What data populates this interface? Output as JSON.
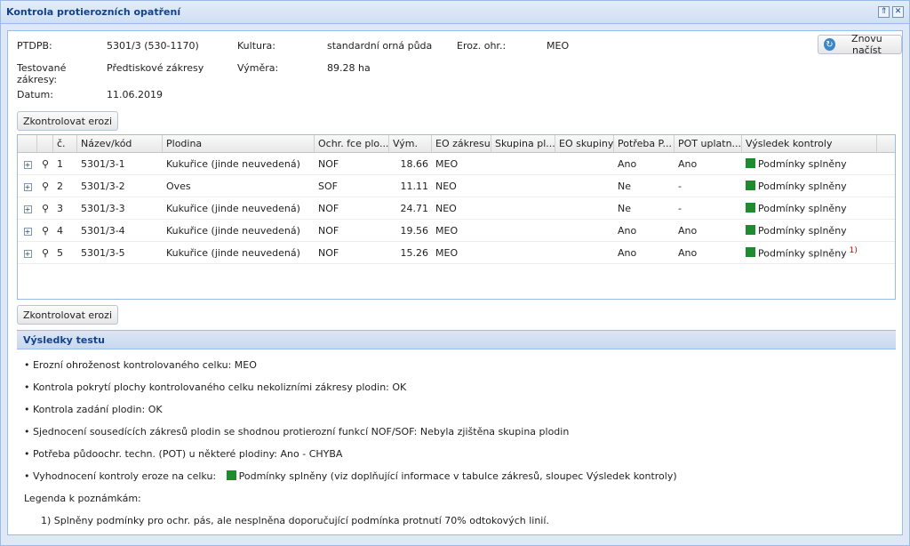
{
  "window": {
    "title": "Kontrola protierozních opatření",
    "tool_collapse": "⇑",
    "tool_close": "✕"
  },
  "info": {
    "ptdpb_label": "PTDPB:",
    "ptdpb_value": "5301/3 (530-1170)",
    "kultura_label": "Kultura:",
    "kultura_value": "standardní orná půda",
    "eroz_label": "Eroz. ohr.:",
    "eroz_value": "MEO",
    "testovane_label": "Testované zákresy:",
    "testovane_value": "Předtiskové zákresy",
    "vymera_label": "Výměra:",
    "vymera_value": "89.28 ha",
    "datum_label": "Datum:",
    "datum_value": "11.06.2019"
  },
  "buttons": {
    "reload": "Znovu načíst",
    "check_top": "Zkontrolovat erozi",
    "check_bottom": "Zkontrolovat erozi"
  },
  "grid": {
    "headers": [
      "",
      "",
      "č.",
      "Název/kód",
      "Plodina",
      "Ochr. fce plo...",
      "Vým.",
      "EO zákresu",
      "Skupina pl...",
      "EO skupiny",
      "Potřeba P...",
      "POT uplatn...",
      "Výsledek kontroly"
    ],
    "rows": [
      {
        "n": "1",
        "kod": "5301/3-1",
        "plodina": "Kukuřice (jinde neuvedená)",
        "fce": "NOF",
        "vym": "18.66",
        "eo": "MEO",
        "skup": "",
        "eos": "",
        "potreba": "Ano",
        "pot": "Ano",
        "vysledek": "Podmínky splněny",
        "note": ""
      },
      {
        "n": "2",
        "kod": "5301/3-2",
        "plodina": "Oves",
        "fce": "SOF",
        "vym": "11.11",
        "eo": "NEO",
        "skup": "",
        "eos": "",
        "potreba": "Ne",
        "pot": "-",
        "vysledek": "Podmínky splněny",
        "note": ""
      },
      {
        "n": "3",
        "kod": "5301/3-3",
        "plodina": "Kukuřice (jinde neuvedená)",
        "fce": "NOF",
        "vym": "24.71",
        "eo": "NEO",
        "skup": "",
        "eos": "",
        "potreba": "Ne",
        "pot": "-",
        "vysledek": "Podmínky splněny",
        "note": ""
      },
      {
        "n": "4",
        "kod": "5301/3-4",
        "plodina": "Kukuřice (jinde neuvedená)",
        "fce": "NOF",
        "vym": "19.56",
        "eo": "MEO",
        "skup": "",
        "eos": "",
        "potreba": "Ano",
        "pot": "Ano",
        "vysledek": "Podmínky splněny",
        "note": ""
      },
      {
        "n": "5",
        "kod": "5301/3-5",
        "plodina": "Kukuřice (jinde neuvedená)",
        "fce": "NOF",
        "vym": "15.26",
        "eo": "MEO",
        "skup": "",
        "eos": "",
        "potreba": "Ano",
        "pot": "Ano",
        "vysledek": "Podmínky splněny",
        "note": "1)"
      }
    ],
    "status_color": "#1e8c2e"
  },
  "results": {
    "title": "Výsledky testu",
    "l1": "• Erozní ohroženost kontrolovaného celku:   MEO",
    "l2": "• Kontrola pokrytí plochy kontrolovaného celku nekolizními zákresy plodin:  OK",
    "l3": "• Kontrola zadání plodin:      OK",
    "l4": "• Sjednocení sousedících zákresů plodin se shodnou protierozní funkcí NOF/SOF:    Nebyla zjištěna skupina plodin",
    "l5": "• Potřeba půdoochr. techn. (POT) u některé plodiny:     Ano - CHYBA",
    "l6_prefix": "• Vyhodnocení kontroly eroze na celku:",
    "l6_text": "Podmínky splněny (viz doplňující informace v tabulce zákresů, sloupec Výsledek kontroly)",
    "legend_label": "Legenda k poznámkám:",
    "legend_note": "1) Splněny podmínky pro ochr. pás, ale nesplněna doporučující podmínka protnutí 70% odtokových linií."
  }
}
